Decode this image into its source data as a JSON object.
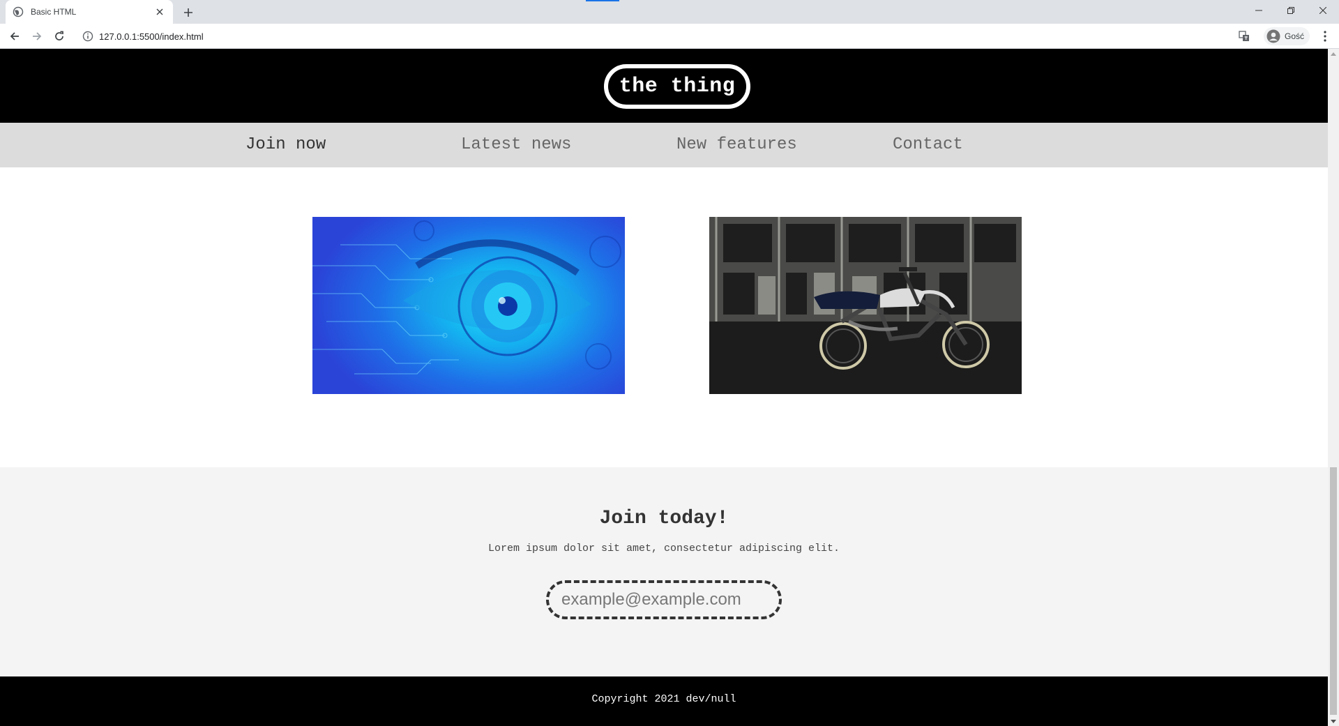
{
  "browser": {
    "tab_title": "Basic HTML",
    "url": "127.0.0.1:5500/index.html",
    "profile_label": "Gość"
  },
  "site": {
    "logo_text": "the thing",
    "nav": [
      {
        "label": "Join now"
      },
      {
        "label": "Latest news"
      },
      {
        "label": "New features"
      },
      {
        "label": "Contact"
      }
    ],
    "join": {
      "title": "Join today!",
      "text": "Lorem ipsum dolor sit amet, consectetur adipiscing elit.",
      "email_placeholder": "example@example.com"
    },
    "footer": "Copyright 2021 dev/null"
  },
  "colors": {
    "header_bg": "#000000",
    "nav_bg": "#dcdcdc",
    "join_bg": "#f4f4f4",
    "tab_indicator": "#1a73e8"
  }
}
